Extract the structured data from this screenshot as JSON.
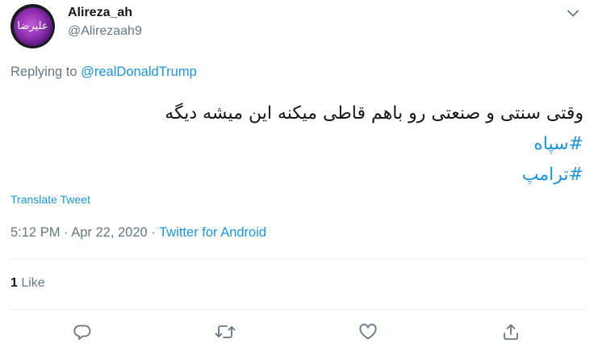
{
  "author": {
    "display_name": "Alireza_ah",
    "handle": "@Alirezaah9",
    "avatar_text": "علیرضا"
  },
  "reply": {
    "prefix": "Replying to ",
    "mention": "@realDonaldTrump"
  },
  "tweet": {
    "text": "وقتی سنتی و صنعتی رو باهم قاطی میکنه این میشه دیگه",
    "hashtags": [
      "#سپاه",
      "#ترامپ"
    ]
  },
  "translate_label": "Translate Tweet",
  "meta": {
    "time": "5:12 PM",
    "separator": " · ",
    "date": "Apr 22, 2020",
    "source": "Twitter for Android"
  },
  "stats": {
    "likes_count": "1",
    "likes_label": " Like"
  },
  "icons": {
    "more": "chevron-down-icon",
    "reply": "reply-icon",
    "retweet": "retweet-icon",
    "like": "heart-icon",
    "share": "share-icon"
  },
  "colors": {
    "link": "#1b95e0",
    "secondary": "#657786",
    "text": "#14171a",
    "divider": "#e6ecf0"
  }
}
